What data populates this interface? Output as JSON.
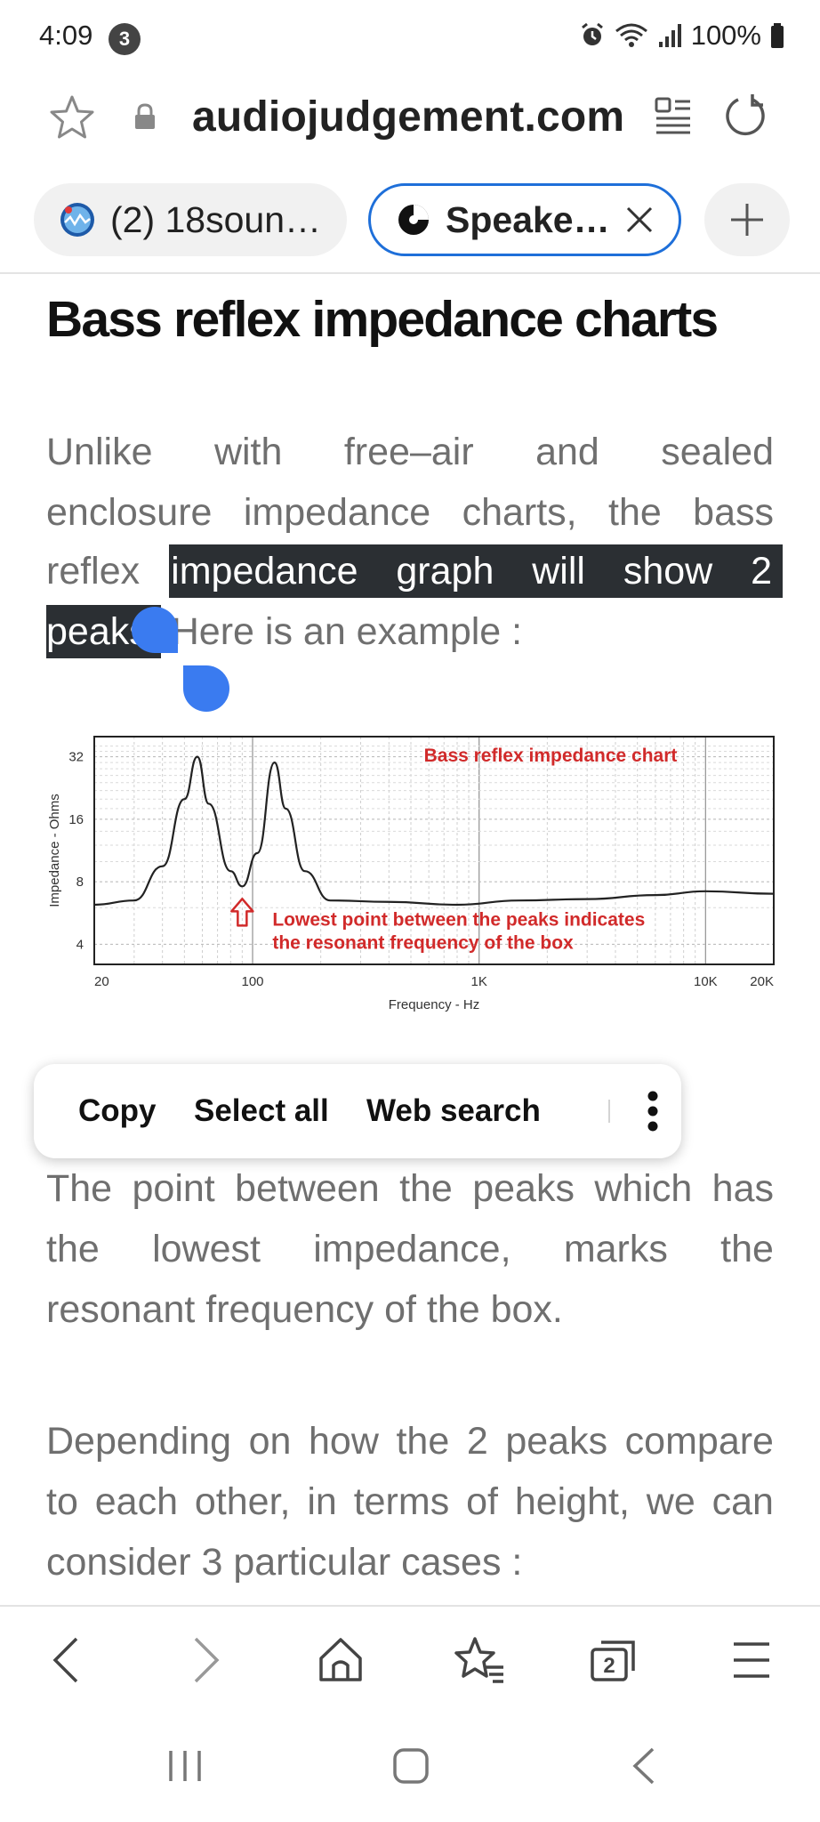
{
  "status": {
    "time": "4:09",
    "notification_count": "3",
    "battery": "100%"
  },
  "browser": {
    "url": "audiojudgement.com",
    "tabs": [
      {
        "label": "(2) 18soun…",
        "active": false
      },
      {
        "label": "Speake…",
        "active": true
      }
    ]
  },
  "article": {
    "title": "Bass reflex impedance charts",
    "para1": {
      "line1_words": [
        "Unlike",
        "with",
        "free–air",
        "and",
        "sealed"
      ],
      "line2_words": [
        "enclosure",
        "impedance",
        "charts,",
        "the",
        "bass"
      ],
      "line3_plain": "reflex",
      "line3_selected_words": [
        "impedance",
        "graph",
        "will",
        "show",
        "2"
      ],
      "line4_selected": "peaks",
      "line4_plain": "Here is an example :"
    },
    "para2": {
      "line1_words": [
        "The",
        "point",
        "between",
        "the",
        "peaks",
        "which",
        "has"
      ],
      "line2_words": [
        "the",
        "lowest",
        "impedance,",
        "marks",
        "the"
      ],
      "line3": "resonant frequency of the box."
    },
    "para3": {
      "line1_words": [
        "Depending",
        "on",
        "how",
        "the",
        "2",
        "peaks",
        "compare"
      ],
      "line2_words": [
        "to",
        "each",
        "other,",
        "in",
        "terms",
        "of",
        "height,",
        "we",
        "can"
      ],
      "line3": "consider 3 particular cases :"
    }
  },
  "chart_data": {
    "type": "line",
    "title": "Bass reflex impedance chart",
    "xlabel": "Frequency - Hz",
    "ylabel": "Impedance - Ohms",
    "x_scale": "log",
    "y_scale": "log",
    "xlim": [
      20,
      20000
    ],
    "ylim": [
      3.2,
      40
    ],
    "x_ticks": [
      {
        "value": 20,
        "label": "20"
      },
      {
        "value": 100,
        "label": "100"
      },
      {
        "value": 1000,
        "label": "1K"
      },
      {
        "value": 10000,
        "label": "10K"
      },
      {
        "value": 20000,
        "label": "20K"
      }
    ],
    "y_ticks": [
      {
        "value": 4,
        "label": "4"
      },
      {
        "value": 8,
        "label": "8"
      },
      {
        "value": 16,
        "label": "16"
      },
      {
        "value": 32,
        "label": "32"
      }
    ],
    "grid": true,
    "series": [
      {
        "color": "#222222",
        "points": [
          [
            20,
            6.2
          ],
          [
            30,
            6.5
          ],
          [
            40,
            9.5
          ],
          [
            50,
            20
          ],
          [
            57,
            32
          ],
          [
            64,
            19
          ],
          [
            80,
            9
          ],
          [
            90,
            7.6
          ],
          [
            105,
            11
          ],
          [
            125,
            30
          ],
          [
            140,
            18
          ],
          [
            170,
            9
          ],
          [
            220,
            6.5
          ],
          [
            400,
            6.4
          ],
          [
            800,
            6.2
          ],
          [
            1500,
            6.5
          ],
          [
            3000,
            6.6
          ],
          [
            6000,
            6.9
          ],
          [
            10000,
            7.2
          ],
          [
            20000,
            7.0
          ]
        ]
      }
    ],
    "annotations": [
      {
        "text": "Lowest point between the peaks indicates",
        "color": "#d12a2a"
      },
      {
        "text": "the resonant frequency of the box",
        "color": "#d12a2a"
      }
    ],
    "annotation_arrow_x": 90
  },
  "context_menu": {
    "items": [
      "Copy",
      "Select all",
      "Web search"
    ]
  },
  "colors": {
    "accent": "#1e6fd9",
    "selection_bg": "#2b2f33",
    "handle": "#3a7bf0",
    "chart_title": "#d12a2a"
  }
}
